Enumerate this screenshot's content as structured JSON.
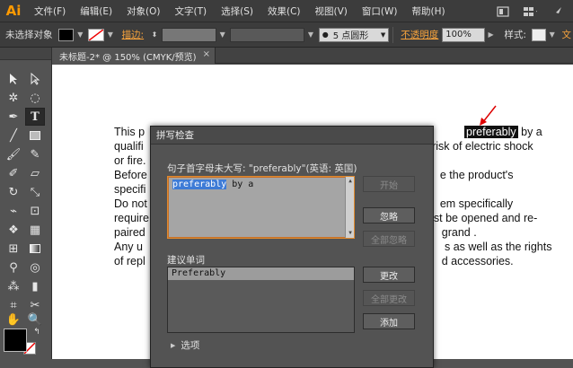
{
  "app": {
    "logo": "Ai"
  },
  "menu": [
    "文件(F)",
    "编辑(E)",
    "对象(O)",
    "文字(T)",
    "选择(S)",
    "效果(C)",
    "视图(V)",
    "窗口(W)",
    "帮助(H)"
  ],
  "menu_icons": [
    "bridge-icon",
    "grid-layout-icon",
    "rocket-icon"
  ],
  "control_bar": {
    "selection_status": "未选择对象",
    "stroke_label": "描边:",
    "brush_label": "5 点圆形",
    "opacity_label": "不透明度",
    "opacity_value": "100%",
    "style_label": "样式:",
    "overflow_char": "文"
  },
  "document_tab": {
    "title": "未标题-2* @ 150% (CMYK/预览)",
    "close": "×"
  },
  "document": {
    "lines": [
      {
        "text": "This p",
        "after": " by a"
      },
      {
        "text": "qualifi",
        "after": "a risk of electric shock"
      },
      {
        "text": "or fire.",
        "after": ""
      },
      {
        "text": "Before",
        "after": "e the product's"
      },
      {
        "text": "specifi",
        "after": ""
      },
      {
        "text": "Do not",
        "after": "em specifically"
      },
      {
        "text": "require",
        "after": "ust be opened and re-"
      },
      {
        "text": "paired",
        "after": "grand ."
      },
      {
        "text": "Any u",
        "after": "s as well as the rights"
      },
      {
        "text": "of repl",
        "after": "d accessories."
      }
    ],
    "highlighted_word": "preferably"
  },
  "dialog": {
    "title": "拼写检查",
    "problem_label": "句子首字母未大写: \"preferably\"(英语: 英国)",
    "problem_selected": "preferably",
    "problem_rest": " by a",
    "suggestions_label": "建议单词",
    "suggestions": [
      "Preferably"
    ],
    "buttons": {
      "start": "开始",
      "ignore": "忽略",
      "ignore_all": "全部忽略",
      "change": "更改",
      "change_all": "全部更改",
      "add": "添加"
    },
    "options_label": "选项"
  }
}
